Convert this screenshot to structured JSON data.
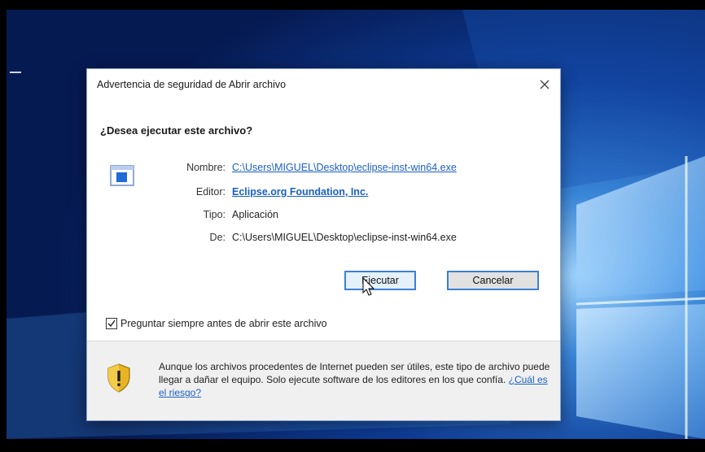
{
  "dialog": {
    "title": "Advertencia de seguridad de Abrir archivo",
    "question": "¿Desea ejecutar este archivo?",
    "fields": [
      {
        "label": "Nombre:",
        "value": "C:\\Users\\MIGUEL\\Desktop\\eclipse-inst-win64.exe"
      },
      {
        "label": "Editor:",
        "value": "Eclipse.org Foundation, Inc."
      },
      {
        "label": "Tipo:",
        "value": "Aplicación"
      },
      {
        "label": "De:",
        "value": "C:\\Users\\MIGUEL\\Desktop\\eclipse-inst-win64.exe"
      }
    ],
    "buttons": {
      "run": "Ejecutar",
      "cancel": "Cancelar"
    },
    "checkbox": {
      "label": "Preguntar siempre antes de abrir este archivo",
      "checked": true
    },
    "warning": {
      "text": "Aunque los archivos procedentes de Internet pueden ser útiles, este tipo de archivo puede llegar a dañar el equipo. Solo ejecute software de los editores en los que confía.",
      "link": "¿Cuál es el riesgo?"
    }
  },
  "icons": {
    "close": "close-icon",
    "file": "application-file-icon",
    "shield": "security-shield-icon",
    "checkmark": "checkmark-icon",
    "cursor": "mouse-pointer-icon"
  },
  "colors": {
    "link": "#1a5fc4",
    "accent_border": "#3c7fd6",
    "wallpaper": "#0a2a6e"
  }
}
